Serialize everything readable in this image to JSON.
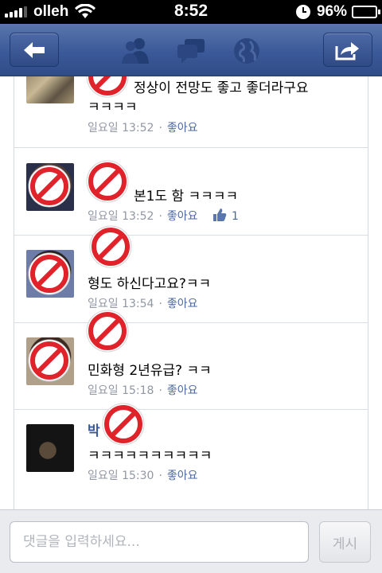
{
  "status_bar": {
    "carrier": "olleh",
    "time": "8:52",
    "battery": "96%",
    "battery_level": 0.96
  },
  "nav": {
    "back_icon": "back-arrow-icon",
    "share_icon": "share-icon",
    "tabs": [
      "friends-icon",
      "messages-icon",
      "globe-icon"
    ]
  },
  "comments": [
    {
      "name": "",
      "lines": [
        "정상이 전망도 좋고 좋더라구요",
        "ㅋㅋㅋㅋ"
      ],
      "time": "일요일 13:52",
      "like_label": "좋아요",
      "likes": null
    },
    {
      "name": "",
      "lines": [
        "본1도 함 ㅋㅋㅋㅋ"
      ],
      "time": "일요일 13:52",
      "like_label": "좋아요",
      "likes": "1"
    },
    {
      "name": "",
      "lines": [
        "형도 하신다고요?ㅋㅋ"
      ],
      "time": "일요일 13:54",
      "like_label": "좋아요",
      "likes": null
    },
    {
      "name": "",
      "lines": [
        "민화형 2년유급? ㅋㅋ"
      ],
      "time": "일요일 15:18",
      "like_label": "좋아요",
      "likes": null
    },
    {
      "name": "박",
      "lines": [
        "ㅋㅋㅋㅋㅋㅋㅋㅋㅋㅋ"
      ],
      "time": "일요일 15:30",
      "like_label": "좋아요",
      "likes": null
    }
  ],
  "composer": {
    "placeholder": "댓글을 입력하세요...",
    "post_label": "게시"
  },
  "colors": {
    "nav_blue": "#3b5998",
    "link": "#4b67a1",
    "block_red": "#e0222b"
  }
}
